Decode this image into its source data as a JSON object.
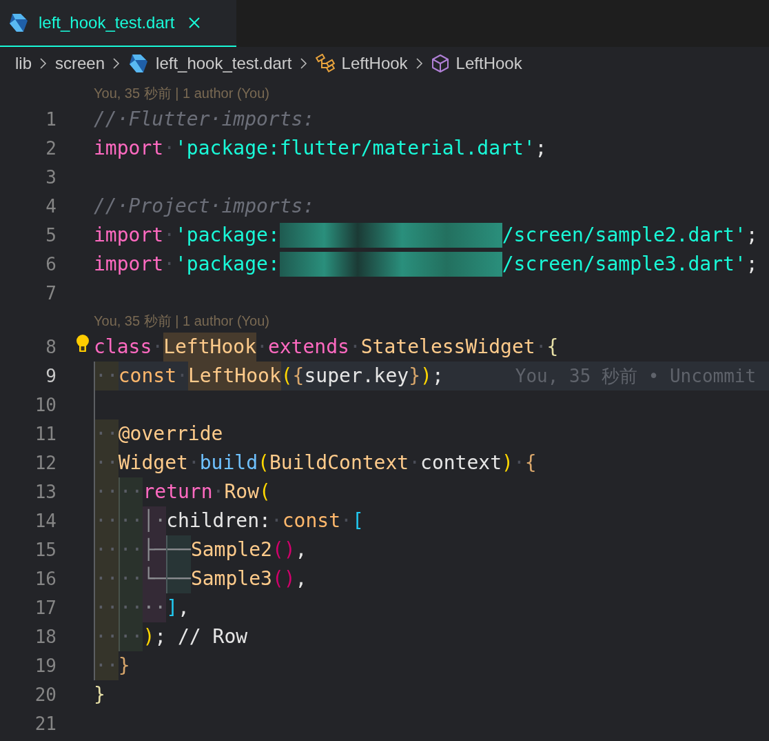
{
  "tab": {
    "label": "left_hook_test.dart",
    "selected": true
  },
  "breadcrumbs": [
    {
      "kind": "folder",
      "label": "lib"
    },
    {
      "kind": "folder",
      "label": "screen"
    },
    {
      "kind": "file",
      "label": "left_hook_test.dart"
    },
    {
      "kind": "class",
      "label": "LeftHook"
    },
    {
      "kind": "constructor",
      "label": "LeftHook"
    }
  ],
  "lines": [
    {
      "kind": "codelens",
      "text": "You, 35 秒前 | 1 author (You)"
    },
    {
      "kind": "code",
      "number": "1",
      "current": false,
      "tokens": [
        {
          "kind": "com",
          "text": "//·Flutter·imports:"
        }
      ]
    },
    {
      "kind": "code",
      "number": "2",
      "current": false,
      "tokens": [
        {
          "kind": "kw",
          "text": "import"
        },
        {
          "kind": "ws",
          "text": "·"
        },
        {
          "kind": "str",
          "text": "'package:flutter/material.dart'"
        },
        {
          "kind": "plain",
          "text": ";"
        }
      ]
    },
    {
      "kind": "code",
      "number": "3",
      "current": false
    },
    {
      "kind": "code",
      "number": "4",
      "current": false,
      "tokens": [
        {
          "kind": "com",
          "text": "//·Project·imports:"
        }
      ]
    },
    {
      "kind": "code",
      "number": "5",
      "current": false,
      "tokens": [
        {
          "kind": "kw",
          "text": "import"
        },
        {
          "kind": "ws",
          "text": "·"
        },
        {
          "kind": "str",
          "text": "'package:"
        },
        {
          "kind": "redacted"
        },
        {
          "kind": "str",
          "text": "/screen/sample2.dart'"
        },
        {
          "kind": "plain",
          "text": ";"
        }
      ]
    },
    {
      "kind": "code",
      "number": "6",
      "current": false,
      "tokens": [
        {
          "kind": "kw",
          "text": "import"
        },
        {
          "kind": "ws",
          "text": "·"
        },
        {
          "kind": "str",
          "text": "'package:"
        },
        {
          "kind": "redacted"
        },
        {
          "kind": "str",
          "text": "/screen/sample3.dart'"
        },
        {
          "kind": "plain",
          "text": ";"
        }
      ]
    },
    {
      "kind": "code",
      "number": "7",
      "current": false
    },
    {
      "kind": "codelens",
      "text": "You, 35 秒前 | 1 author (You)"
    },
    {
      "kind": "code",
      "number": "8",
      "current": false,
      "tokens": [
        {
          "kind": "lightbulb"
        },
        {
          "kind": "kw",
          "text": "class"
        },
        {
          "kind": "ws",
          "text": "·"
        },
        {
          "kind": "typehl",
          "text": "LeftHook"
        },
        {
          "kind": "ws",
          "text": "·"
        },
        {
          "kind": "kw",
          "text": "extends"
        },
        {
          "kind": "ws",
          "text": "·"
        },
        {
          "kind": "type",
          "text": "StatelessWidget"
        },
        {
          "kind": "ws",
          "text": "·"
        },
        {
          "kind": "bkhaki",
          "text": "{"
        }
      ]
    },
    {
      "kind": "code",
      "number": "9",
      "current": true,
      "blame": "You, 35 秒前 • Uncommit",
      "tokens": [
        {
          "kind": "i1",
          "text": "··"
        },
        {
          "kind": "storage",
          "text": "const"
        },
        {
          "kind": "ws",
          "text": "·"
        },
        {
          "kind": "typehl",
          "text": "LeftHook"
        },
        {
          "kind": "bgold",
          "text": "("
        },
        {
          "kind": "borange",
          "text": "{"
        },
        {
          "kind": "plain",
          "text": "super.key"
        },
        {
          "kind": "borange",
          "text": "}"
        },
        {
          "kind": "bgold",
          "text": ")"
        },
        {
          "kind": "plain",
          "text": ";"
        }
      ]
    },
    {
      "kind": "code",
      "number": "10",
      "current": false,
      "tokens": [
        {
          "kind": "guide"
        }
      ]
    },
    {
      "kind": "code",
      "number": "11",
      "current": false,
      "tokens": [
        {
          "kind": "i1",
          "text": "··"
        },
        {
          "kind": "type",
          "text": "@override"
        }
      ]
    },
    {
      "kind": "code",
      "number": "12",
      "current": false,
      "tokens": [
        {
          "kind": "i1",
          "text": "··"
        },
        {
          "kind": "type",
          "text": "Widget"
        },
        {
          "kind": "ws",
          "text": "·"
        },
        {
          "kind": "fn",
          "text": "build"
        },
        {
          "kind": "bgold",
          "text": "("
        },
        {
          "kind": "type",
          "text": "BuildContext"
        },
        {
          "kind": "ws",
          "text": "·"
        },
        {
          "kind": "plain",
          "text": "context"
        },
        {
          "kind": "bgold",
          "text": ")"
        },
        {
          "kind": "ws",
          "text": "·"
        },
        {
          "kind": "borange",
          "text": "{"
        }
      ]
    },
    {
      "kind": "code",
      "number": "13",
      "current": false,
      "tokens": [
        {
          "kind": "i1",
          "text": "··"
        },
        {
          "kind": "i2",
          "text": "··"
        },
        {
          "kind": "kw",
          "text": "return"
        },
        {
          "kind": "ws",
          "text": "·"
        },
        {
          "kind": "type",
          "text": "Row"
        },
        {
          "kind": "bgold",
          "text": "("
        }
      ]
    },
    {
      "kind": "code",
      "number": "14",
      "current": false,
      "tokens": [
        {
          "kind": "i1",
          "text": "··"
        },
        {
          "kind": "i2",
          "text": "··"
        },
        {
          "kind": "i3",
          "text": "│·"
        },
        {
          "kind": "plain",
          "text": "children:"
        },
        {
          "kind": "ws",
          "text": "·"
        },
        {
          "kind": "storage",
          "text": "const"
        },
        {
          "kind": "ws",
          "text": "·"
        },
        {
          "kind": "bblue",
          "text": "["
        }
      ]
    },
    {
      "kind": "code",
      "number": "15",
      "current": false,
      "tokens": [
        {
          "kind": "i1",
          "text": "··"
        },
        {
          "kind": "i2",
          "text": "··"
        },
        {
          "kind": "i3",
          "text": "├─"
        },
        {
          "kind": "i4",
          "text": "──"
        },
        {
          "kind": "type",
          "text": "Sample2"
        },
        {
          "kind": "bmagenta",
          "text": "()"
        },
        {
          "kind": "plain",
          "text": ","
        }
      ]
    },
    {
      "kind": "code",
      "number": "16",
      "current": false,
      "tokens": [
        {
          "kind": "i1",
          "text": "··"
        },
        {
          "kind": "i2",
          "text": "··"
        },
        {
          "kind": "i3",
          "text": "└─"
        },
        {
          "kind": "i4",
          "text": "──"
        },
        {
          "kind": "type",
          "text": "Sample3"
        },
        {
          "kind": "bmagenta",
          "text": "()"
        },
        {
          "kind": "plain",
          "text": ","
        }
      ]
    },
    {
      "kind": "code",
      "number": "17",
      "current": false,
      "tokens": [
        {
          "kind": "i1",
          "text": "··"
        },
        {
          "kind": "i2",
          "text": "··"
        },
        {
          "kind": "i3",
          "text": "··"
        },
        {
          "kind": "bblue",
          "text": "]"
        },
        {
          "kind": "plain",
          "text": ","
        }
      ]
    },
    {
      "kind": "code",
      "number": "18",
      "current": false,
      "tokens": [
        {
          "kind": "i1",
          "text": "··"
        },
        {
          "kind": "i2",
          "text": "··"
        },
        {
          "kind": "bgold",
          "text": ")"
        },
        {
          "kind": "plain",
          "text": "; // Row"
        }
      ]
    },
    {
      "kind": "code",
      "number": "19",
      "current": false,
      "tokens": [
        {
          "kind": "i1",
          "text": "··"
        },
        {
          "kind": "borange",
          "text": "}"
        }
      ]
    },
    {
      "kind": "code",
      "number": "20",
      "current": false,
      "tokens": [
        {
          "kind": "bkhaki",
          "text": "}"
        }
      ]
    },
    {
      "kind": "code",
      "number": "21",
      "current": false
    }
  ]
}
